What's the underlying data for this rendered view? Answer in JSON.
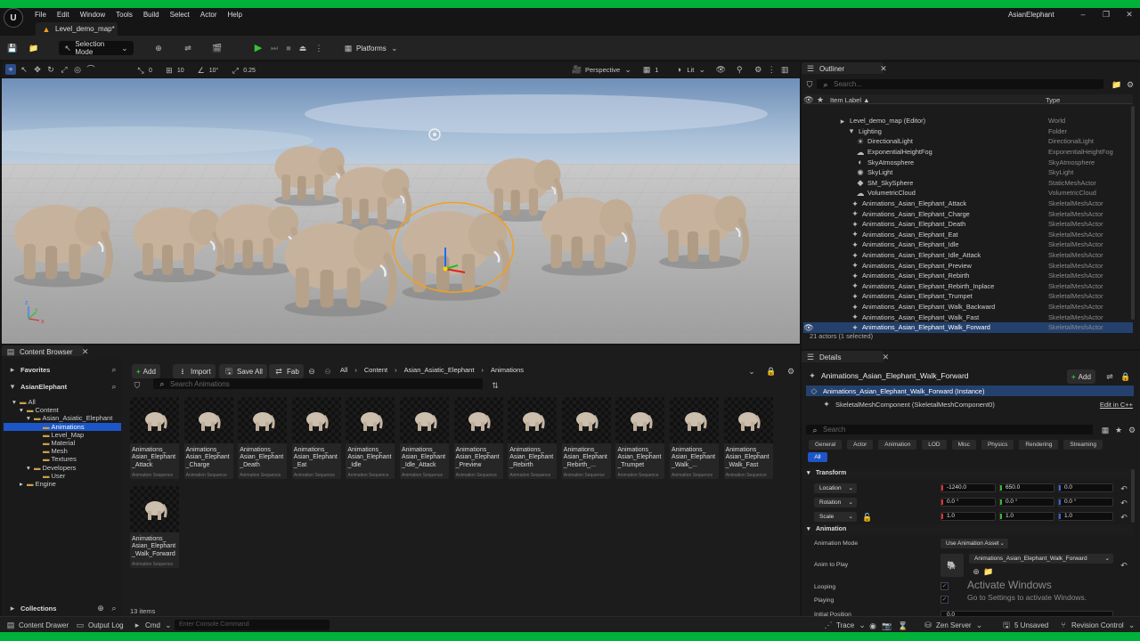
{
  "menu": [
    "File",
    "Edit",
    "Window",
    "Tools",
    "Build",
    "Select",
    "Actor",
    "Help"
  ],
  "project_name": "AsianElephant",
  "level_tab": "Level_demo_map*",
  "toolbar": {
    "selection_mode": "Selection Mode",
    "platforms": "Platforms"
  },
  "viewport": {
    "snap_translate": "0",
    "snap_grid": "10",
    "snap_rotate": "10°",
    "snap_scale": "0.25",
    "perspective": "Perspective",
    "lit": "Lit",
    "count": "1"
  },
  "outliner": {
    "title": "Outliner",
    "search_placeholder": "Search...",
    "col_label": "Item Label ▲",
    "col_type": "Type",
    "rows": [
      {
        "label": "Level_demo_map (Editor)",
        "type": "World",
        "indent": 38,
        "icon": "▸"
      },
      {
        "label": "Lighting",
        "type": "Folder",
        "indent": 48,
        "icon": "▾"
      },
      {
        "label": "DirectionalLight",
        "type": "DirectionalLight",
        "indent": 58,
        "icon": "☀"
      },
      {
        "label": "ExponentialHeightFog",
        "type": "ExponentialHeightFog",
        "indent": 58,
        "icon": "☁"
      },
      {
        "label": "SkyAtmosphere",
        "type": "SkyAtmosphere",
        "indent": 58,
        "icon": "◐"
      },
      {
        "label": "SkyLight",
        "type": "SkyLight",
        "indent": 58,
        "icon": "✺"
      },
      {
        "label": "SM_SkySphere",
        "type": "StaticMeshActor",
        "indent": 58,
        "icon": "◆"
      },
      {
        "label": "VolumetricCloud",
        "type": "VolumetricCloud",
        "indent": 58,
        "icon": "☁"
      },
      {
        "label": "Animations_Asian_Elephant_Attack",
        "type": "SkeletalMeshActor",
        "indent": 52,
        "icon": "✦"
      },
      {
        "label": "Animations_Asian_Elephant_Charge",
        "type": "SkeletalMeshActor",
        "indent": 52,
        "icon": "✦"
      },
      {
        "label": "Animations_Asian_Elephant_Death",
        "type": "SkeletalMeshActor",
        "indent": 52,
        "icon": "✦"
      },
      {
        "label": "Animations_Asian_Elephant_Eat",
        "type": "SkeletalMeshActor",
        "indent": 52,
        "icon": "✦"
      },
      {
        "label": "Animations_Asian_Elephant_Idle",
        "type": "SkeletalMeshActor",
        "indent": 52,
        "icon": "✦"
      },
      {
        "label": "Animations_Asian_Elephant_Idle_Attack",
        "type": "SkeletalMeshActor",
        "indent": 52,
        "icon": "✦"
      },
      {
        "label": "Animations_Asian_Elephant_Preview",
        "type": "SkeletalMeshActor",
        "indent": 52,
        "icon": "✦"
      },
      {
        "label": "Animations_Asian_Elephant_Rebirth",
        "type": "SkeletalMeshActor",
        "indent": 52,
        "icon": "✦"
      },
      {
        "label": "Animations_Asian_Elephant_Rebirth_Inplace",
        "type": "SkeletalMeshActor",
        "indent": 52,
        "icon": "✦"
      },
      {
        "label": "Animations_Asian_Elephant_Trumpet",
        "type": "SkeletalMeshActor",
        "indent": 52,
        "icon": "✦"
      },
      {
        "label": "Animations_Asian_Elephant_Walk_Backward",
        "type": "SkeletalMeshActor",
        "indent": 52,
        "icon": "✦"
      },
      {
        "label": "Animations_Asian_Elephant_Walk_Fast",
        "type": "SkeletalMeshActor",
        "indent": 52,
        "icon": "✦"
      },
      {
        "label": "Animations_Asian_Elephant_Walk_Forward",
        "type": "SkeletalMeshActor",
        "indent": 52,
        "icon": "✦",
        "selected": true
      }
    ],
    "status": "21 actors (1 selected)"
  },
  "content_browser": {
    "title": "Content Browser",
    "add": "Add",
    "import": "Import",
    "save_all": "Save All",
    "fab": "Fab",
    "path": [
      "All",
      "Content",
      "Asian_Asiatic_Elephant",
      "Animations"
    ],
    "search_placeholder": "Search Animations",
    "favorites": "Favorites",
    "project": "AsianElephant",
    "collections": "Collections",
    "tree": [
      {
        "label": "All",
        "indent": 10,
        "icon": "▾"
      },
      {
        "label": "Content",
        "indent": 18,
        "icon": "▾"
      },
      {
        "label": "Asian_Asiatic_Elephant",
        "indent": 26,
        "icon": "▾"
      },
      {
        "label": "Animations",
        "indent": 36,
        "icon": "",
        "selected": true
      },
      {
        "label": "Level_Map",
        "indent": 36,
        "icon": ""
      },
      {
        "label": "Material",
        "indent": 36,
        "icon": ""
      },
      {
        "label": "Mesh",
        "indent": 36,
        "icon": ""
      },
      {
        "label": "Textures",
        "indent": 36,
        "icon": ""
      },
      {
        "label": "Developers",
        "indent": 26,
        "icon": "▾"
      },
      {
        "label": "User",
        "indent": 36,
        "icon": ""
      },
      {
        "label": "Engine",
        "indent": 18,
        "icon": "▸"
      }
    ],
    "assets": [
      "Animations_\nAsian_Elephant\n_Attack",
      "Animations_\nAsian_Elephant\n_Charge",
      "Animations_\nAsian_Elephant\n_Death",
      "Animations_\nAsian_Elephant\n_Eat",
      "Animations_\nAsian_Elephant\n_Idle",
      "Animations_\nAsian_Elephant\n_Idle_Attack",
      "Animations_\nAsian_Elephant\n_Preview",
      "Animations_\nAsian_Elephant\n_Rebirth",
      "Animations_\nAsian_Elephant\n_Rebirth_...",
      "Animations_\nAsian_Elephant\n_Trumpet",
      "Animations_\nAsian_Elephant\n_Walk_...",
      "Animations_\nAsian_Elephant\n_Walk_Fast",
      "Animations_\nAsian_Elephant\n_Walk_Forward"
    ],
    "asset_type": "Animation Sequence",
    "item_count": "13 items"
  },
  "details": {
    "title": "Details",
    "actor_name": "Animations_Asian_Elephant_Walk_Forward",
    "add": "Add",
    "instance": "Animations_Asian_Elephant_Walk_Forward (Instance)",
    "component": "SkeletalMeshComponent (SkeletalMeshComponent0)",
    "edit_cpp": "Edit in C++",
    "search_placeholder": "Search",
    "tabs": [
      "General",
      "Actor",
      "Animation",
      "LOD",
      "Misc",
      "Physics",
      "Rendering",
      "Streaming"
    ],
    "all": "All",
    "transform_section": "Transform",
    "location": {
      "label": "Location",
      "x": "-1240.0",
      "y": "650.0",
      "z": "0.0"
    },
    "rotation": {
      "label": "Rotation",
      "x": "0.0 °",
      "y": "0.0 °",
      "z": "0.0 °"
    },
    "scale": {
      "label": "Scale",
      "x": "1.0",
      "y": "1.0",
      "z": "1.0"
    },
    "animation_section": "Animation",
    "animation_mode_label": "Animation Mode",
    "animation_mode": "Use Animation Asset",
    "anim_to_play_label": "Anim to Play",
    "anim_to_play": "Animations_Asian_Elephant_Walk_Forward",
    "looping_label": "Looping",
    "playing_label": "Playing",
    "initial_position_label": "Initial Position",
    "initial_position": "0.0"
  },
  "watermark": {
    "title": "Activate Windows",
    "sub": "Go to Settings to activate Windows."
  },
  "statusbar": {
    "content_drawer": "Content Drawer",
    "output_log": "Output Log",
    "cmd": "Cmd",
    "console_placeholder": "Enter Console Command",
    "trace": "Trace",
    "zen_server": "Zen Server",
    "unsaved": "5 Unsaved",
    "revision_control": "Revision Control"
  },
  "colors": {
    "accent": "#1d56c7",
    "selected": "#24416e",
    "play": "#34c534",
    "app_border": "#00b13a"
  }
}
